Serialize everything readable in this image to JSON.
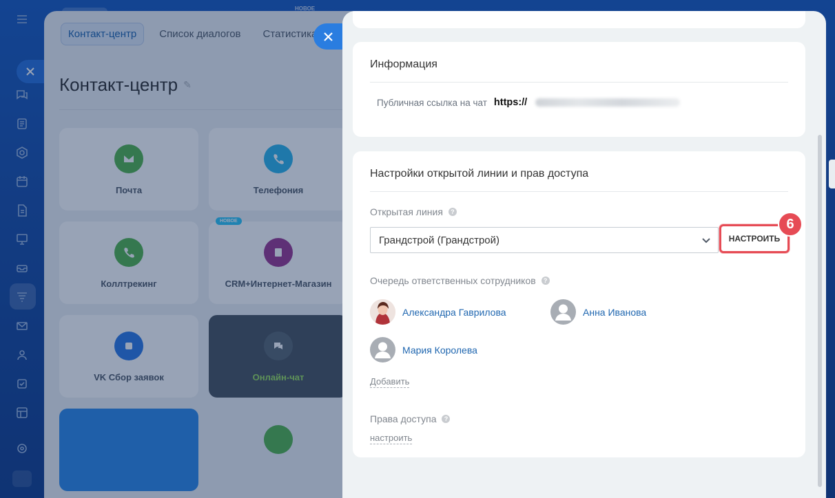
{
  "background": {
    "top_badge": "НОВОЕ",
    "tabs": [
      {
        "label": "Контакт-центр",
        "active": true
      },
      {
        "label": "Список диалогов",
        "active": false
      },
      {
        "label": "Статистика ди",
        "active": false
      }
    ],
    "title": "Контакт-центр",
    "tiles": [
      {
        "label": "Почта",
        "icon": "mail-icon",
        "color": "#55b54f"
      },
      {
        "label": "Телефония",
        "icon": "phone-icon",
        "color": "#2fb6ea"
      },
      {
        "label": "Коллтрекинг",
        "icon": "calltracking-icon",
        "color": "#55b54f"
      },
      {
        "label": "CRM+Интернет-Магазин",
        "icon": "shop-icon",
        "color": "#9b3a92",
        "badge": "НОВОЕ"
      },
      {
        "label": "VK Сбор заявок",
        "icon": "vk-icon",
        "color": "#2f7be6"
      },
      {
        "label": "Онлайн-чат",
        "icon": "chat-icon",
        "color": "#5b6873"
      }
    ]
  },
  "slider": {
    "info": {
      "title": "Информация",
      "public_link_label": "Публичная ссылка на чат",
      "public_link_value": "https://"
    },
    "settings": {
      "title": "Настройки открытой линии и прав доступа",
      "open_line_label": "Открытая линия",
      "open_line_value": "Грандстрой (Грандстрой)",
      "configure_button": "НАСТРОИТЬ",
      "step_number": "6",
      "queue_label": "Очередь ответственных сотрудников",
      "queue": [
        {
          "name": "Александра Гаврилова",
          "has_photo": true
        },
        {
          "name": "Анна Иванова",
          "has_photo": false
        },
        {
          "name": "Мария Королева",
          "has_photo": false
        }
      ],
      "add_link": "Добавить",
      "access_label": "Права доступа",
      "access_link": "настроить"
    }
  },
  "colors": {
    "accent": "#2067b0",
    "highlight": "#e64b55"
  }
}
